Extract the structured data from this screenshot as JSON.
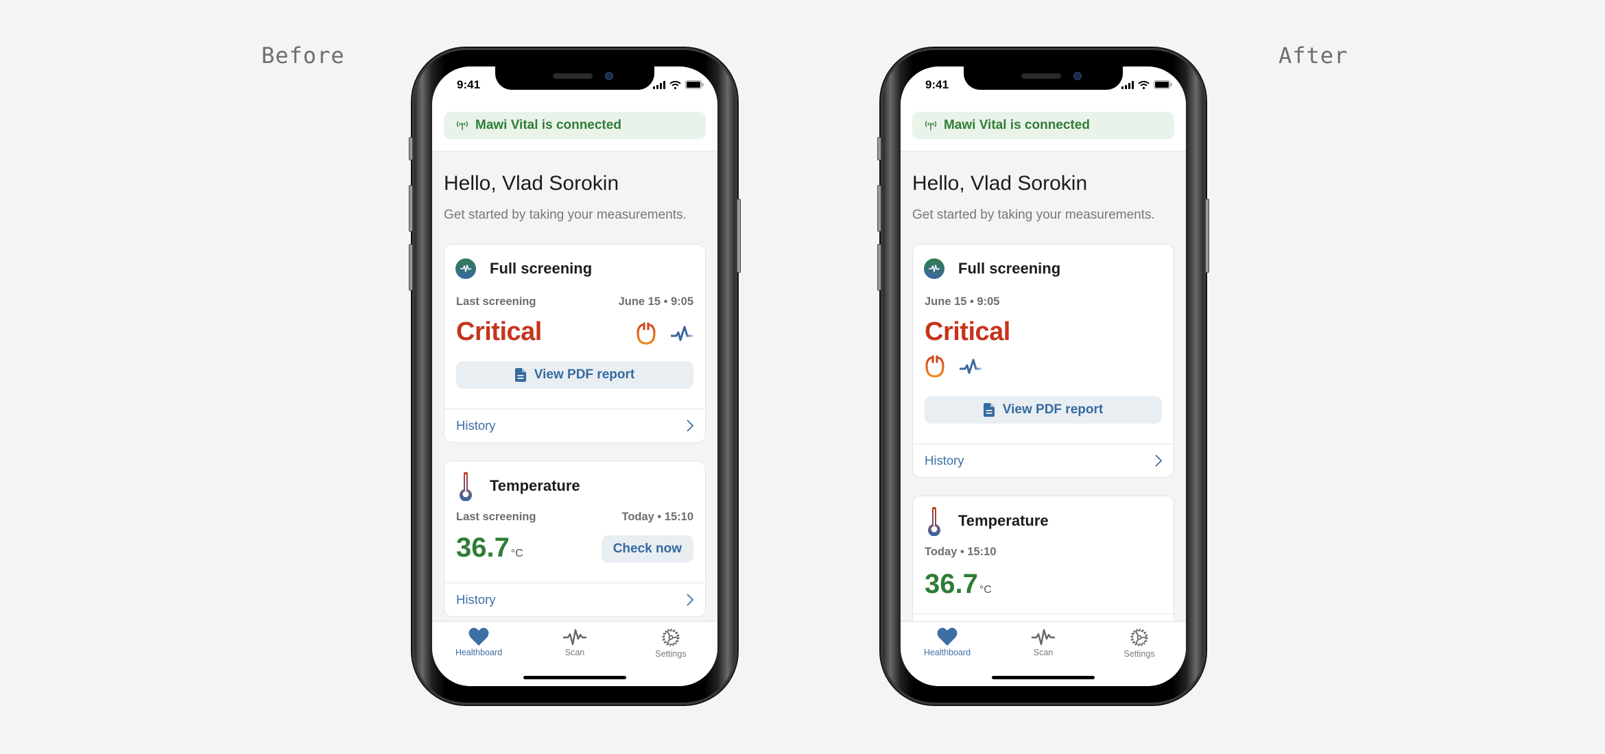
{
  "labels": {
    "before": "Before",
    "after": "After"
  },
  "colors": {
    "background": "#f4f4f4",
    "accent_blue": "#3d6fa6",
    "critical_red": "#c5341c",
    "ok_green": "#2e7d35",
    "banner_bg": "#eaf3ea",
    "button_bg": "#e9eef3"
  },
  "phones": [
    {
      "variant": "before",
      "status_bar": {
        "time": "9:41",
        "icons": [
          "signal-icon",
          "wifi-icon",
          "battery-icon"
        ]
      },
      "connection_banner": {
        "icon": "antenna-icon",
        "text": "Mawi Vital is connected"
      },
      "greeting": "Hello, Vlad Sorokin",
      "subtitle": "Get started by taking your measurements.",
      "full_screening": {
        "icon": "pulse-circle-icon",
        "title": "Full screening",
        "meta_label": "Last screening",
        "meta_value": "June 15 • 9:05",
        "status": "Critical",
        "status_icons": [
          "stethoscope-icon",
          "ecg-icon"
        ],
        "pdf_button": "View PDF report",
        "history": "History"
      },
      "temperature": {
        "icon": "thermometer-icon",
        "title": "Temperature",
        "meta_label": "Last screening",
        "meta_value": "Today • 15:10",
        "value": "36.7",
        "unit": "°C",
        "check_button": "Check now",
        "history": "History"
      },
      "tabs": [
        {
          "label": "Healthboard",
          "icon": "heart-icon",
          "active": true
        },
        {
          "label": "Scan",
          "icon": "pulse-icon",
          "active": false
        },
        {
          "label": "Settings",
          "icon": "gear-icon",
          "active": false
        }
      ]
    },
    {
      "variant": "after",
      "status_bar": {
        "time": "9:41",
        "icons": [
          "signal-icon",
          "wifi-icon",
          "battery-icon"
        ]
      },
      "connection_banner": {
        "icon": "antenna-icon",
        "text": "Mawi Vital is connected"
      },
      "greeting": "Hello, Vlad Sorokin",
      "subtitle": "Get started by taking your measurements.",
      "full_screening": {
        "icon": "pulse-circle-icon",
        "title": "Full screening",
        "meta_value": "June 15 • 9:05",
        "status": "Critical",
        "status_icons": [
          "stethoscope-icon",
          "ecg-icon"
        ],
        "pdf_button": "View PDF report",
        "history": "History"
      },
      "temperature": {
        "icon": "thermometer-icon",
        "title": "Temperature",
        "meta_value": "Today • 15:10",
        "value": "36.7",
        "unit": "°C"
      },
      "tabs": [
        {
          "label": "Healthboard",
          "icon": "heart-icon",
          "active": true
        },
        {
          "label": "Scan",
          "icon": "pulse-icon",
          "active": false
        },
        {
          "label": "Settings",
          "icon": "gear-icon",
          "active": false
        }
      ]
    }
  ]
}
